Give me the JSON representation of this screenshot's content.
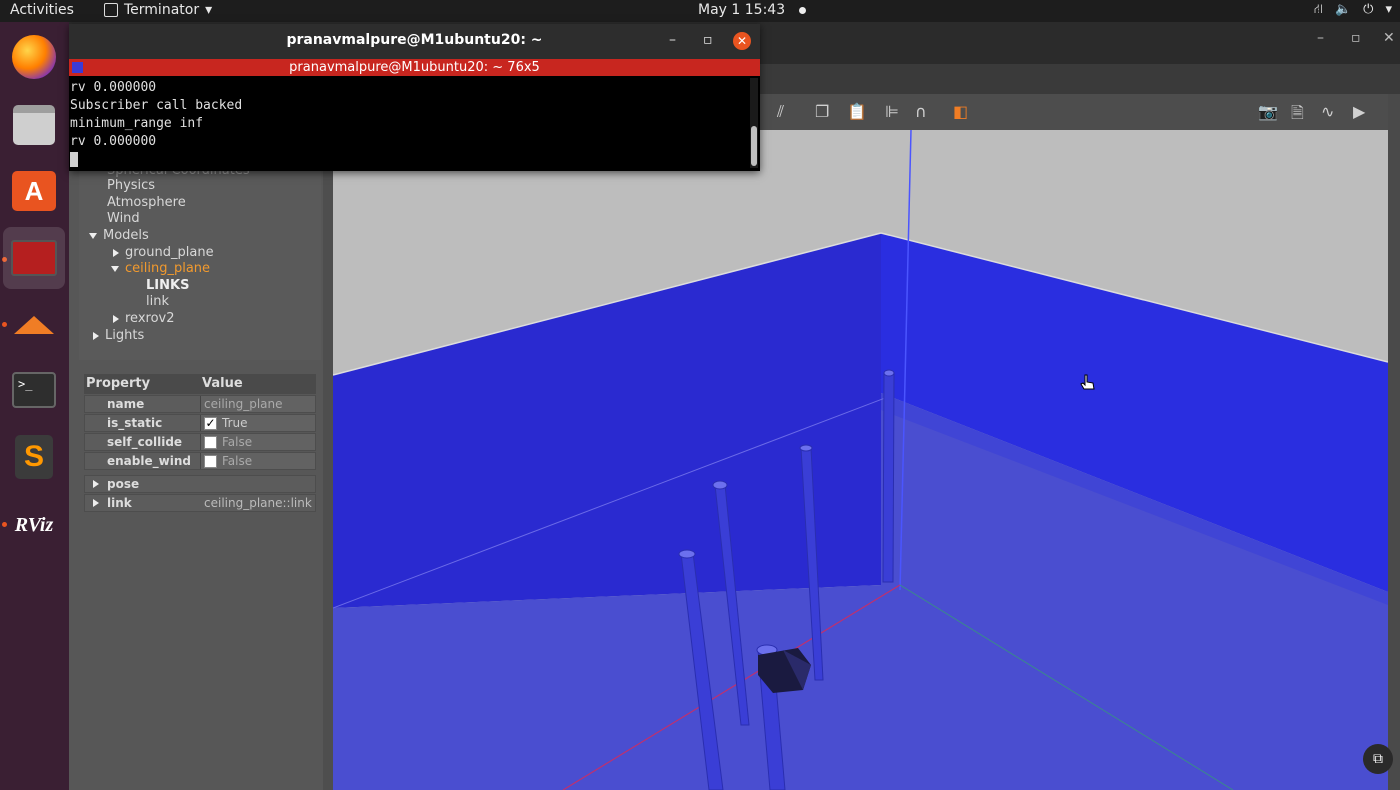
{
  "topbar": {
    "activities": "Activities",
    "app_name": "Terminator",
    "clock": "May 1  15:43"
  },
  "terminal": {
    "title": "pranavmalpure@M1ubuntu20: ~",
    "tab_title": "pranavmalpure@M1ubuntu20: ~ 76x5",
    "lines": [
      "rv 0.000000",
      "Subscriber call backed",
      "minimum_range inf",
      "rv 0.000000"
    ]
  },
  "tree": {
    "spherical": "Spherical Coordinates",
    "physics": "Physics",
    "atmosphere": "Atmosphere",
    "wind": "Wind",
    "models": "Models",
    "ground_plane": "ground_plane",
    "ceiling_plane": "ceiling_plane",
    "links": "LINKS",
    "link": "link",
    "rexrov2": "rexrov2",
    "lights": "Lights"
  },
  "properties": {
    "header_property": "Property",
    "header_value": "Value",
    "rows": [
      {
        "key": "name",
        "value": "ceiling_plane"
      },
      {
        "key": "is_static",
        "value": "True",
        "checked": true
      },
      {
        "key": "self_collide",
        "value": "False",
        "checked": false
      },
      {
        "key": "enable_wind",
        "value": "False",
        "checked": false
      }
    ],
    "pose": "pose",
    "link_key": "link",
    "link_value": "ceiling_plane::link"
  },
  "dock": {
    "rviz_label": "RViz"
  },
  "colors": {
    "wall_blue": "#2a2ee0",
    "floor_blue": "#4a4ed0",
    "selection_orange": "#f29a2e",
    "terminal_tab_red": "#c8261f"
  }
}
